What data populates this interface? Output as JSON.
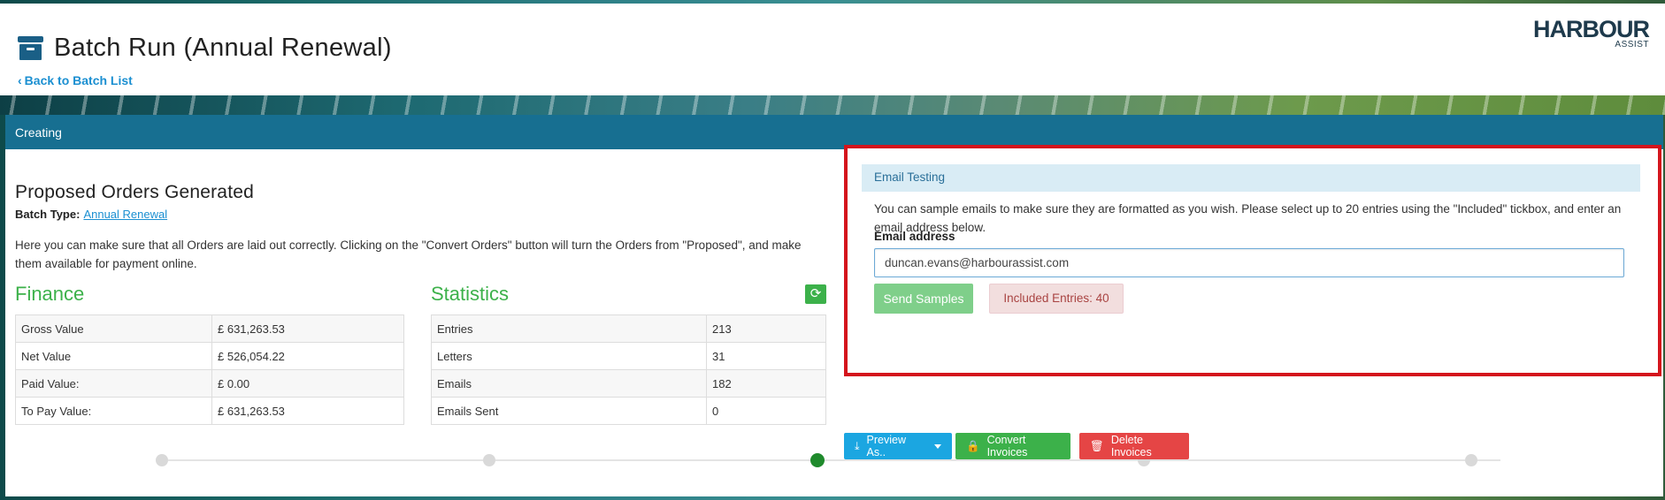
{
  "header": {
    "title": "Batch Run (Annual Renewal)",
    "title_icon": "archive-box-icon",
    "back_link": "Back to Batch List",
    "logo_main": "HARBOUR",
    "logo_sub": "ASSIST"
  },
  "panel": {
    "status": "Creating"
  },
  "main": {
    "heading": "Proposed Orders Generated",
    "batch_type_label": "Batch Type:",
    "batch_type_value": "Annual Renewal",
    "description": "Here you can make sure that all Orders are laid out correctly. Clicking on the \"Convert Orders\" button will turn the Orders from \"Proposed\", and make them available for payment online."
  },
  "finance": {
    "title": "Finance",
    "rows": [
      {
        "label": "Gross Value",
        "value": "£ 631,263.53"
      },
      {
        "label": "Net Value",
        "value": "£ 526,054.22"
      },
      {
        "label": "Paid Value:",
        "value": "£ 0.00"
      },
      {
        "label": "To Pay Value:",
        "value": "£ 631,263.53"
      }
    ]
  },
  "statistics": {
    "title": "Statistics",
    "refresh_icon": "refresh-icon",
    "rows": [
      {
        "label": "Entries",
        "value": "213"
      },
      {
        "label": "Letters",
        "value": "31"
      },
      {
        "label": "Emails",
        "value": "182"
      },
      {
        "label": "Emails Sent",
        "value": "0"
      }
    ]
  },
  "email_testing": {
    "title": "Email Testing",
    "description": "You can sample emails to make sure they are formatted as you wish. Please select up to 20 entries using the \"Included\" tickbox, and enter an email address below.",
    "email_label": "Email address",
    "email_value": "duncan.evans@harbourassist.com",
    "send_button": "Send Samples",
    "included_badge": "Included Entries: 40"
  },
  "actions": {
    "preview": "Preview As..",
    "convert": "Convert Invoices",
    "delete": "Delete Invoices"
  },
  "stepper": {
    "steps": 5,
    "active_step": 3
  },
  "colors": {
    "primary": "#176f91",
    "success": "#3cb14a",
    "danger": "#e54545",
    "info": "#1ba6e1",
    "highlight_border": "#d4141c"
  }
}
